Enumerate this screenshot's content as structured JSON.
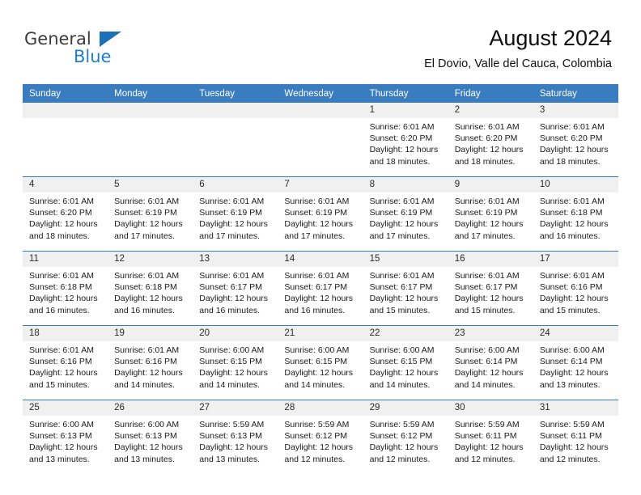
{
  "brand": {
    "name_part1": "General",
    "name_part2": "Blue",
    "triangle_color": "#1d6fb8",
    "blue_text_color": "#1d7fd0"
  },
  "header": {
    "title": "August 2024",
    "subtitle": "El Dovio, Valle del Cauca, Colombia"
  },
  "theme": {
    "header_row_bg": "#3a7cc0",
    "day_band_bg": "#f0f0f0",
    "row_separator": "#3a7cc0"
  },
  "calendar": {
    "weekday_headers": [
      "Sunday",
      "Monday",
      "Tuesday",
      "Wednesday",
      "Thursday",
      "Friday",
      "Saturday"
    ],
    "weeks": [
      [
        {
          "day": "",
          "lines": []
        },
        {
          "day": "",
          "lines": []
        },
        {
          "day": "",
          "lines": []
        },
        {
          "day": "",
          "lines": []
        },
        {
          "day": "1",
          "lines": [
            "Sunrise: 6:01 AM",
            "Sunset: 6:20 PM",
            "Daylight: 12 hours",
            "and 18 minutes."
          ]
        },
        {
          "day": "2",
          "lines": [
            "Sunrise: 6:01 AM",
            "Sunset: 6:20 PM",
            "Daylight: 12 hours",
            "and 18 minutes."
          ]
        },
        {
          "day": "3",
          "lines": [
            "Sunrise: 6:01 AM",
            "Sunset: 6:20 PM",
            "Daylight: 12 hours",
            "and 18 minutes."
          ]
        }
      ],
      [
        {
          "day": "4",
          "lines": [
            "Sunrise: 6:01 AM",
            "Sunset: 6:20 PM",
            "Daylight: 12 hours",
            "and 18 minutes."
          ]
        },
        {
          "day": "5",
          "lines": [
            "Sunrise: 6:01 AM",
            "Sunset: 6:19 PM",
            "Daylight: 12 hours",
            "and 17 minutes."
          ]
        },
        {
          "day": "6",
          "lines": [
            "Sunrise: 6:01 AM",
            "Sunset: 6:19 PM",
            "Daylight: 12 hours",
            "and 17 minutes."
          ]
        },
        {
          "day": "7",
          "lines": [
            "Sunrise: 6:01 AM",
            "Sunset: 6:19 PM",
            "Daylight: 12 hours",
            "and 17 minutes."
          ]
        },
        {
          "day": "8",
          "lines": [
            "Sunrise: 6:01 AM",
            "Sunset: 6:19 PM",
            "Daylight: 12 hours",
            "and 17 minutes."
          ]
        },
        {
          "day": "9",
          "lines": [
            "Sunrise: 6:01 AM",
            "Sunset: 6:19 PM",
            "Daylight: 12 hours",
            "and 17 minutes."
          ]
        },
        {
          "day": "10",
          "lines": [
            "Sunrise: 6:01 AM",
            "Sunset: 6:18 PM",
            "Daylight: 12 hours",
            "and 16 minutes."
          ]
        }
      ],
      [
        {
          "day": "11",
          "lines": [
            "Sunrise: 6:01 AM",
            "Sunset: 6:18 PM",
            "Daylight: 12 hours",
            "and 16 minutes."
          ]
        },
        {
          "day": "12",
          "lines": [
            "Sunrise: 6:01 AM",
            "Sunset: 6:18 PM",
            "Daylight: 12 hours",
            "and 16 minutes."
          ]
        },
        {
          "day": "13",
          "lines": [
            "Sunrise: 6:01 AM",
            "Sunset: 6:17 PM",
            "Daylight: 12 hours",
            "and 16 minutes."
          ]
        },
        {
          "day": "14",
          "lines": [
            "Sunrise: 6:01 AM",
            "Sunset: 6:17 PM",
            "Daylight: 12 hours",
            "and 16 minutes."
          ]
        },
        {
          "day": "15",
          "lines": [
            "Sunrise: 6:01 AM",
            "Sunset: 6:17 PM",
            "Daylight: 12 hours",
            "and 15 minutes."
          ]
        },
        {
          "day": "16",
          "lines": [
            "Sunrise: 6:01 AM",
            "Sunset: 6:17 PM",
            "Daylight: 12 hours",
            "and 15 minutes."
          ]
        },
        {
          "day": "17",
          "lines": [
            "Sunrise: 6:01 AM",
            "Sunset: 6:16 PM",
            "Daylight: 12 hours",
            "and 15 minutes."
          ]
        }
      ],
      [
        {
          "day": "18",
          "lines": [
            "Sunrise: 6:01 AM",
            "Sunset: 6:16 PM",
            "Daylight: 12 hours",
            "and 15 minutes."
          ]
        },
        {
          "day": "19",
          "lines": [
            "Sunrise: 6:01 AM",
            "Sunset: 6:16 PM",
            "Daylight: 12 hours",
            "and 14 minutes."
          ]
        },
        {
          "day": "20",
          "lines": [
            "Sunrise: 6:00 AM",
            "Sunset: 6:15 PM",
            "Daylight: 12 hours",
            "and 14 minutes."
          ]
        },
        {
          "day": "21",
          "lines": [
            "Sunrise: 6:00 AM",
            "Sunset: 6:15 PM",
            "Daylight: 12 hours",
            "and 14 minutes."
          ]
        },
        {
          "day": "22",
          "lines": [
            "Sunrise: 6:00 AM",
            "Sunset: 6:15 PM",
            "Daylight: 12 hours",
            "and 14 minutes."
          ]
        },
        {
          "day": "23",
          "lines": [
            "Sunrise: 6:00 AM",
            "Sunset: 6:14 PM",
            "Daylight: 12 hours",
            "and 14 minutes."
          ]
        },
        {
          "day": "24",
          "lines": [
            "Sunrise: 6:00 AM",
            "Sunset: 6:14 PM",
            "Daylight: 12 hours",
            "and 13 minutes."
          ]
        }
      ],
      [
        {
          "day": "25",
          "lines": [
            "Sunrise: 6:00 AM",
            "Sunset: 6:13 PM",
            "Daylight: 12 hours",
            "and 13 minutes."
          ]
        },
        {
          "day": "26",
          "lines": [
            "Sunrise: 6:00 AM",
            "Sunset: 6:13 PM",
            "Daylight: 12 hours",
            "and 13 minutes."
          ]
        },
        {
          "day": "27",
          "lines": [
            "Sunrise: 5:59 AM",
            "Sunset: 6:13 PM",
            "Daylight: 12 hours",
            "and 13 minutes."
          ]
        },
        {
          "day": "28",
          "lines": [
            "Sunrise: 5:59 AM",
            "Sunset: 6:12 PM",
            "Daylight: 12 hours",
            "and 12 minutes."
          ]
        },
        {
          "day": "29",
          "lines": [
            "Sunrise: 5:59 AM",
            "Sunset: 6:12 PM",
            "Daylight: 12 hours",
            "and 12 minutes."
          ]
        },
        {
          "day": "30",
          "lines": [
            "Sunrise: 5:59 AM",
            "Sunset: 6:11 PM",
            "Daylight: 12 hours",
            "and 12 minutes."
          ]
        },
        {
          "day": "31",
          "lines": [
            "Sunrise: 5:59 AM",
            "Sunset: 6:11 PM",
            "Daylight: 12 hours",
            "and 12 minutes."
          ]
        }
      ]
    ]
  }
}
